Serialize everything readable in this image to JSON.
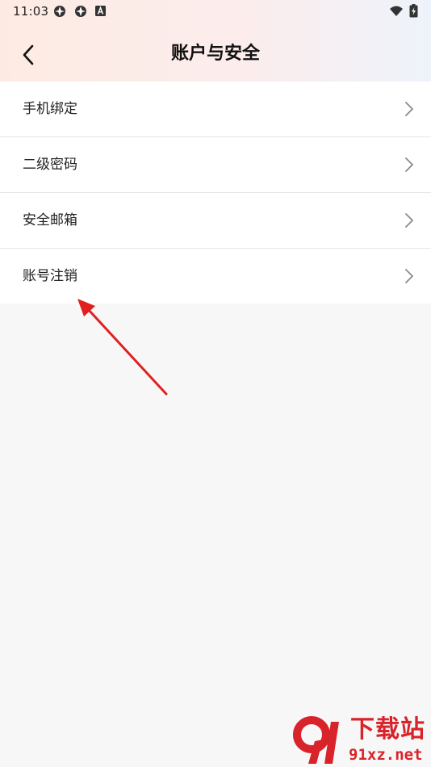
{
  "status_bar": {
    "time": "11:03",
    "icons": [
      "app-notification-icon",
      "app-notification-icon",
      "keyboard-a-icon",
      "wifi-icon",
      "battery-charging-icon"
    ]
  },
  "header": {
    "back_icon": "back-chevron-icon",
    "title": "账户与安全"
  },
  "menu": {
    "items": [
      {
        "label": "手机绑定",
        "icon": "chevron-right-icon"
      },
      {
        "label": "二级密码",
        "icon": "chevron-right-icon"
      },
      {
        "label": "安全邮箱",
        "icon": "chevron-right-icon"
      },
      {
        "label": "账号注销",
        "icon": "chevron-right-icon"
      }
    ]
  },
  "annotation": {
    "color": "#e02020"
  },
  "watermark": {
    "title": "下载站",
    "url": "91xz.net",
    "color": "#d8232a"
  },
  "colors": {
    "background": "#f7f7f7",
    "card": "#ffffff",
    "divider": "#e6e6e6",
    "text": "#222222"
  }
}
